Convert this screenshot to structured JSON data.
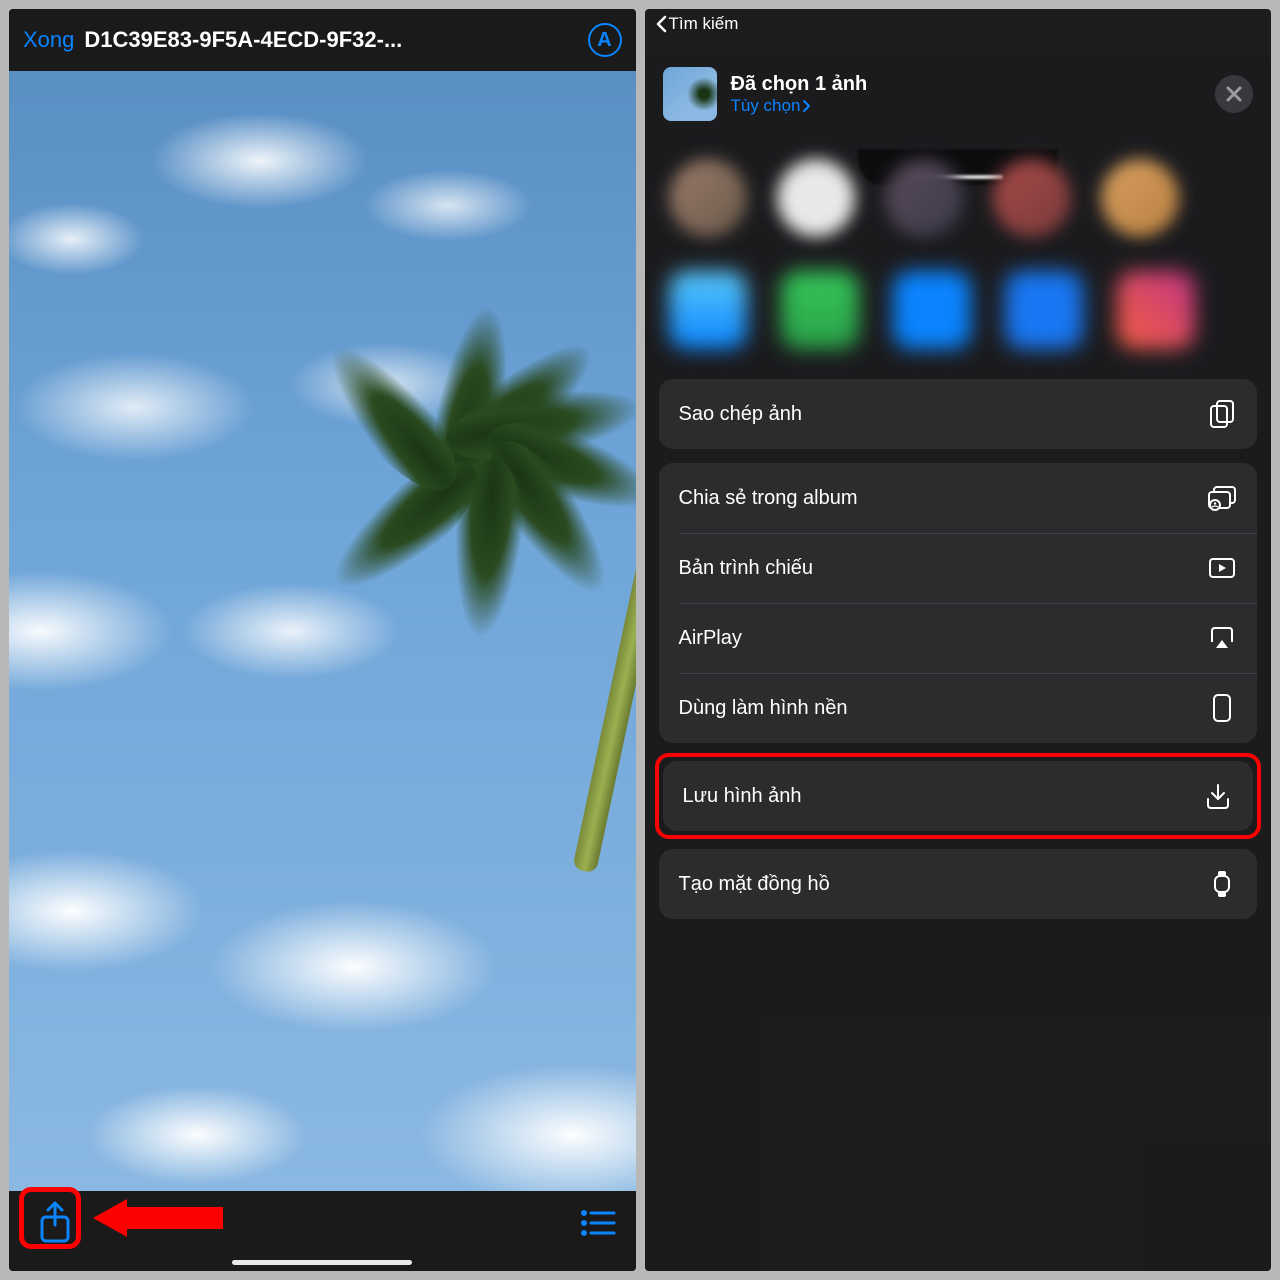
{
  "left": {
    "done": "Xong",
    "filename": "D1C39E83-9F5A-4ECD-9F32-...",
    "markup_initial": "A"
  },
  "right": {
    "back_label": "Tìm kiếm",
    "sheet_title": "Đã chọn 1 ảnh",
    "sheet_options": "Tùy chọn",
    "actions": {
      "copy": "Sao chép ảnh",
      "share_album": "Chia sẻ trong album",
      "slideshow": "Bản trình chiếu",
      "airplay": "AirPlay",
      "wallpaper": "Dùng làm hình nền",
      "save": "Lưu hình ảnh",
      "watchface": "Tạo mặt đồng hồ"
    }
  },
  "colors": {
    "accent": "#0a84ff",
    "highlight": "#fd0100"
  }
}
